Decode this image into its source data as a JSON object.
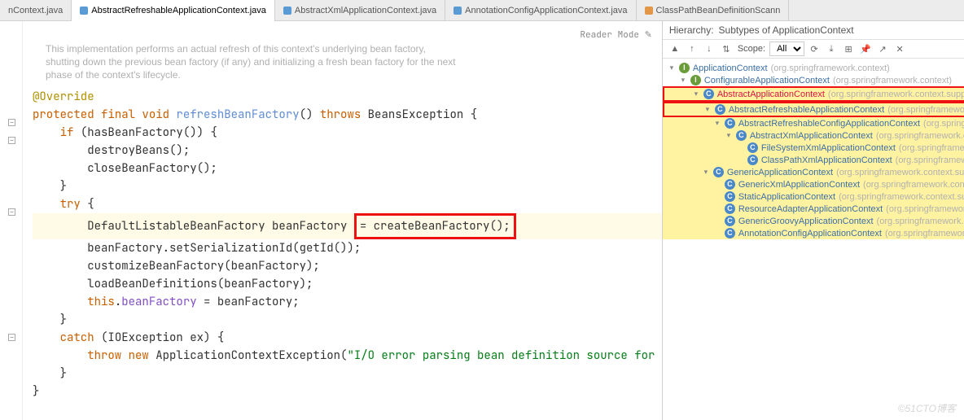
{
  "tabs": {
    "t0": "nContext.java",
    "t1": "AbstractRefreshableApplicationContext.java",
    "t2": "AbstractXmlApplicationContext.java",
    "t3": "AnnotationConfigApplicationContext.java",
    "t4": "ClassPathBeanDefinitionScann"
  },
  "editor": {
    "reader_mode": "Reader Mode",
    "doc": "This implementation performs an actual refresh of this context's underlying bean factory, shutting down the previous bean factory (if any) and initializing a fresh bean factory for the next phase of the context's lifecycle.",
    "anno": "@Override",
    "sig_mod1": "protected",
    "sig_mod2": "final",
    "sig_ret": "void",
    "sig_name": "refreshBeanFactory",
    "sig_throws": "throws",
    "sig_exc": "BeansException",
    "if_kw": "if",
    "if_cond": "hasBeanFactory",
    "destroy": "destroyBeans",
    "close": "closeBeanFactory",
    "try_kw": "try",
    "dflt_type": "DefaultListableBeanFactory",
    "var": "beanFactory",
    "create": "createBeanFactory",
    "setSer": "setSerializationId",
    "getId": "getId",
    "customize": "customizeBeanFactory",
    "loadDefs": "loadBeanDefinitions",
    "this_kw": "this",
    "field": "beanFactory",
    "catch_kw": "catch",
    "ioexc": "IOException",
    "exvar": "ex",
    "throw_kw": "throw",
    "new_kw": "new",
    "appexc": "ApplicationContextException",
    "errstr": "\"I/O error parsing bean definition source for "
  },
  "hierarchy": {
    "title_label": "Hierarchy:",
    "subtitle": "Subtypes of ApplicationContext",
    "scope_label": "Scope:",
    "scope_value": "All",
    "tree": {
      "n0": {
        "name": "ApplicationContext",
        "pkg": "(org.springframework.context)"
      },
      "n1": {
        "name": "ConfigurableApplicationContext",
        "pkg": "(org.springframework.context)"
      },
      "n2": {
        "name": "AbstractApplicationContext",
        "pkg": "(org.springframework.context.support)"
      },
      "n3": {
        "name": "AbstractRefreshableApplicationContext",
        "pkg": "(org.springframework.context.support)"
      },
      "n4": {
        "name": "AbstractRefreshableConfigApplicationContext",
        "pkg": "(org.springframework.context.supp"
      },
      "n5": {
        "name": "AbstractXmlApplicationContext",
        "pkg": "(org.springframework.context.support)"
      },
      "n6": {
        "name": "FileSystemXmlApplicationContext",
        "pkg": "(org.springframework.context.support)"
      },
      "n7": {
        "name": "ClassPathXmlApplicationContext",
        "pkg": "(org.springframework.context.support)"
      },
      "n8": {
        "name": "GenericApplicationContext",
        "pkg": "(org.springframework.context.support)"
      },
      "n9": {
        "name": "GenericXmlApplicationContext",
        "pkg": "(org.springframework.context.support)"
      },
      "n10": {
        "name": "StaticApplicationContext",
        "pkg": "(org.springframework.context.support)"
      },
      "n11": {
        "name": "ResourceAdapterApplicationContext",
        "pkg": "(org.springframework.jca.context)"
      },
      "n12": {
        "name": "GenericGroovyApplicationContext",
        "pkg": "(org.springframework.context.support)"
      },
      "n13": {
        "name": "AnnotationConfigApplicationContext",
        "pkg": "(org.springframework.context.annotation)"
      }
    }
  },
  "watermark": "©51CTO博客"
}
